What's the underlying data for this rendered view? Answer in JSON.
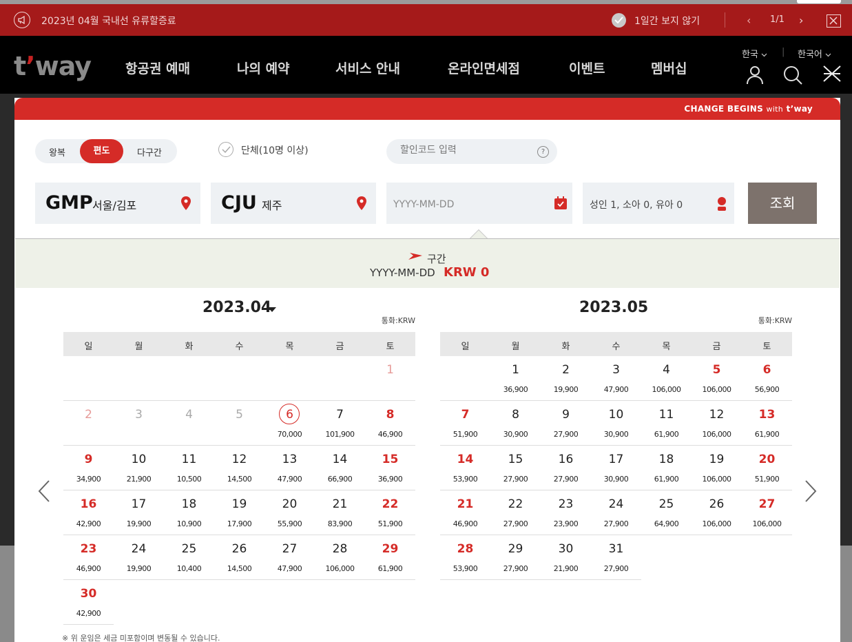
{
  "notice": {
    "text": "2023년 04월 국내선 유류할증료",
    "hide_label": "1일간 보지 않기",
    "pager": "1/1",
    "prev": "‹",
    "next": "›"
  },
  "header": {
    "logo_main": "t",
    "logo_apos": "’",
    "logo_rest": "way",
    "nav": [
      "항공권 예매",
      "나의 예약",
      "서비스 안내",
      "온라인면세점",
      "이벤트",
      "멤버십"
    ],
    "country": "한국",
    "language": "한국어"
  },
  "booking": {
    "slogan_main": "CHANGE BEGINS",
    "slogan_with": "with",
    "slogan_brand": "t’way",
    "trip_types": [
      "왕복",
      "편도",
      "다구간"
    ],
    "selected_trip": "편도",
    "group_label": "단체(10명 이상)",
    "promo_placeholder": "할인코드 입력",
    "promo_help": "?",
    "origin_code": "GMP",
    "origin_city": "서울/김포",
    "dest_code": "CJU",
    "dest_city": "제주",
    "date_placeholder": "YYYY-MM-DD",
    "passengers": "성인 1, 소아 0, 유아 0",
    "search_label": "조회"
  },
  "segment": {
    "label": "구간",
    "date": "YYYY-MM-DD",
    "price": "KRW 0"
  },
  "calendar": {
    "weekdays": [
      "일",
      "월",
      "화",
      "수",
      "목",
      "금",
      "토"
    ],
    "currency_label": "통화:KRW",
    "months": [
      {
        "title": "2023.04",
        "days": [
          {
            "d": "1",
            "p": "",
            "s": "pastred"
          },
          {
            "d": "2",
            "p": "",
            "s": "pastred"
          },
          {
            "d": "3",
            "p": "",
            "s": "past"
          },
          {
            "d": "4",
            "p": "",
            "s": "past"
          },
          {
            "d": "5",
            "p": "",
            "s": "past"
          },
          {
            "d": "6",
            "p": "70,000",
            "s": "today"
          },
          {
            "d": "7",
            "p": "101,900",
            "s": ""
          },
          {
            "d": "8",
            "p": "46,900",
            "s": "red"
          },
          {
            "d": "9",
            "p": "34,900",
            "s": "red"
          },
          {
            "d": "10",
            "p": "21,900",
            "s": ""
          },
          {
            "d": "11",
            "p": "10,500",
            "s": ""
          },
          {
            "d": "12",
            "p": "14,500",
            "s": ""
          },
          {
            "d": "13",
            "p": "47,900",
            "s": ""
          },
          {
            "d": "14",
            "p": "66,900",
            "s": ""
          },
          {
            "d": "15",
            "p": "36,900",
            "s": "red"
          },
          {
            "d": "16",
            "p": "42,900",
            "s": "red"
          },
          {
            "d": "17",
            "p": "19,900",
            "s": ""
          },
          {
            "d": "18",
            "p": "10,900",
            "s": ""
          },
          {
            "d": "19",
            "p": "17,900",
            "s": ""
          },
          {
            "d": "20",
            "p": "55,900",
            "s": ""
          },
          {
            "d": "21",
            "p": "83,900",
            "s": ""
          },
          {
            "d": "22",
            "p": "51,900",
            "s": "red"
          },
          {
            "d": "23",
            "p": "46,900",
            "s": "red"
          },
          {
            "d": "24",
            "p": "19,900",
            "s": ""
          },
          {
            "d": "25",
            "p": "10,400",
            "s": ""
          },
          {
            "d": "26",
            "p": "14,500",
            "s": ""
          },
          {
            "d": "27",
            "p": "47,900",
            "s": ""
          },
          {
            "d": "28",
            "p": "106,000",
            "s": ""
          },
          {
            "d": "29",
            "p": "61,900",
            "s": "red"
          },
          {
            "d": "30",
            "p": "42,900",
            "s": "red"
          }
        ]
      },
      {
        "title": "2023.05",
        "days": [
          {
            "d": "1",
            "p": "36,900",
            "s": ""
          },
          {
            "d": "2",
            "p": "19,900",
            "s": ""
          },
          {
            "d": "3",
            "p": "47,900",
            "s": ""
          },
          {
            "d": "4",
            "p": "106,000",
            "s": ""
          },
          {
            "d": "5",
            "p": "106,000",
            "s": "red"
          },
          {
            "d": "6",
            "p": "56,900",
            "s": "red"
          },
          {
            "d": "7",
            "p": "51,900",
            "s": "red"
          },
          {
            "d": "8",
            "p": "30,900",
            "s": ""
          },
          {
            "d": "9",
            "p": "27,900",
            "s": ""
          },
          {
            "d": "10",
            "p": "30,900",
            "s": ""
          },
          {
            "d": "11",
            "p": "61,900",
            "s": ""
          },
          {
            "d": "12",
            "p": "106,000",
            "s": ""
          },
          {
            "d": "13",
            "p": "61,900",
            "s": "red"
          },
          {
            "d": "14",
            "p": "53,900",
            "s": "red"
          },
          {
            "d": "15",
            "p": "27,900",
            "s": ""
          },
          {
            "d": "16",
            "p": "27,900",
            "s": ""
          },
          {
            "d": "17",
            "p": "30,900",
            "s": ""
          },
          {
            "d": "18",
            "p": "61,900",
            "s": ""
          },
          {
            "d": "19",
            "p": "106,000",
            "s": ""
          },
          {
            "d": "20",
            "p": "51,900",
            "s": "red"
          },
          {
            "d": "21",
            "p": "46,900",
            "s": "red"
          },
          {
            "d": "22",
            "p": "27,900",
            "s": ""
          },
          {
            "d": "23",
            "p": "23,900",
            "s": ""
          },
          {
            "d": "24",
            "p": "27,900",
            "s": ""
          },
          {
            "d": "25",
            "p": "64,900",
            "s": ""
          },
          {
            "d": "26",
            "p": "106,000",
            "s": ""
          },
          {
            "d": "27",
            "p": "106,000",
            "s": "red"
          },
          {
            "d": "28",
            "p": "53,900",
            "s": "red"
          },
          {
            "d": "29",
            "p": "27,900",
            "s": ""
          },
          {
            "d": "30",
            "p": "21,900",
            "s": ""
          },
          {
            "d": "31",
            "p": "27,900",
            "s": ""
          }
        ]
      }
    ],
    "footnote": "※ 위 운임은 세금 미포함이며 변동될 수 있습니다."
  },
  "colors": {
    "brand_red": "#d52b27",
    "notice_bg": "#a51a1a",
    "header_bg": "#000000",
    "search_btn": "#7d726c"
  }
}
